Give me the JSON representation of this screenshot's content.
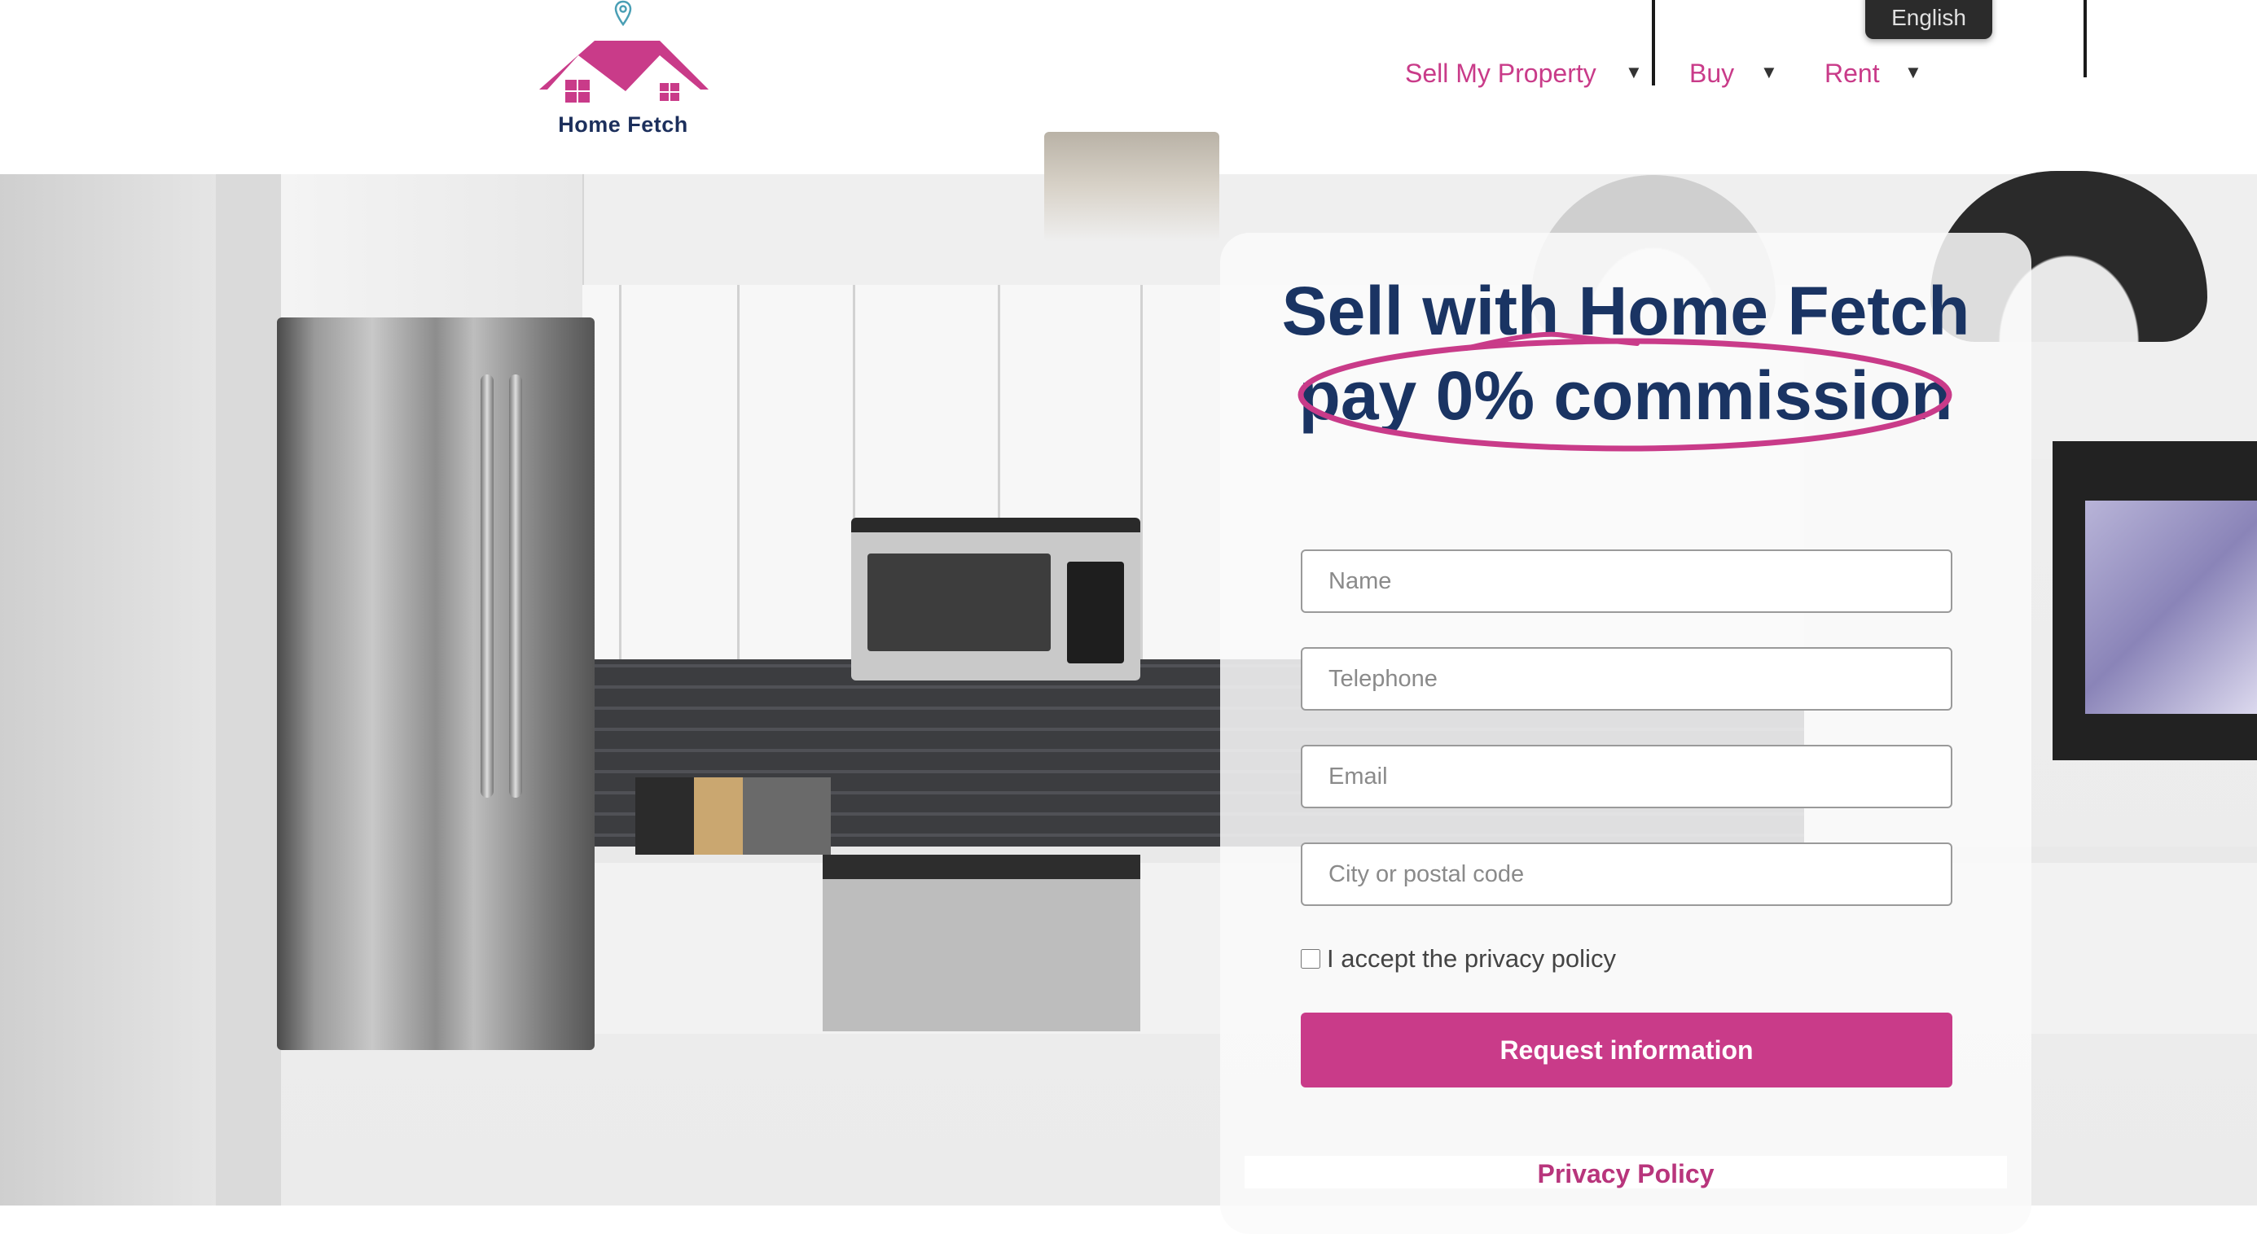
{
  "brand": {
    "name": "Home Fetch",
    "primary_color": "#c93b89",
    "navy_color": "#1a3463",
    "icons": [
      "location-pin-icon",
      "house-logo-icon"
    ]
  },
  "language": {
    "label": "English"
  },
  "nav": {
    "items": [
      {
        "label": "Sell My Property",
        "arrow": "▼"
      },
      {
        "label": "Buy",
        "arrow": "▼"
      },
      {
        "label": "Rent",
        "arrow": "▼"
      }
    ]
  },
  "hero": {
    "headline_line1": "Sell with Home Fetch",
    "headline_line2": "pay 0% commission"
  },
  "form": {
    "name_placeholder": "Name",
    "telephone_placeholder": "Telephone",
    "email_placeholder": "Email",
    "city_placeholder": "City or postal code",
    "privacy_checkbox_label": "I accept the privacy policy",
    "privacy_checked": false,
    "submit_label": "Request information"
  },
  "footer": {
    "privacy_policy_label": "Privacy Policy"
  }
}
